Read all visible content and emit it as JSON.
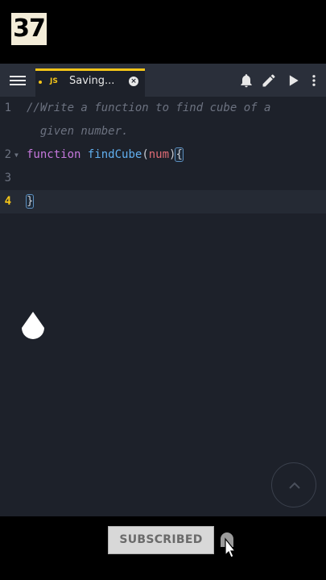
{
  "overlay": {
    "badge_number": "37"
  },
  "toolbar": {
    "tab": {
      "language": "JS",
      "title": "Saving...",
      "close_glyph": "×"
    },
    "icons": [
      "menu-icon",
      "bell-icon",
      "pencil-icon",
      "play-icon",
      "more-vertical-icon"
    ]
  },
  "editor": {
    "lines": [
      {
        "number": "1",
        "text": "//Write a function to find cube of a"
      },
      {
        "number": "",
        "text": "  given number."
      },
      {
        "number": "2",
        "keyword": "function",
        "fn": "findCube",
        "open_paren": "(",
        "param": "num",
        "close_paren": ")",
        "brace": "{"
      },
      {
        "number": "3",
        "text": ""
      },
      {
        "number": "4",
        "brace": "}"
      }
    ],
    "active_line": "4"
  },
  "subscribe": {
    "label": "SUBSCRIBED"
  },
  "colors": {
    "accent": "#f5c518",
    "background": "#1d212a",
    "toolbar": "#2a2f3a"
  }
}
